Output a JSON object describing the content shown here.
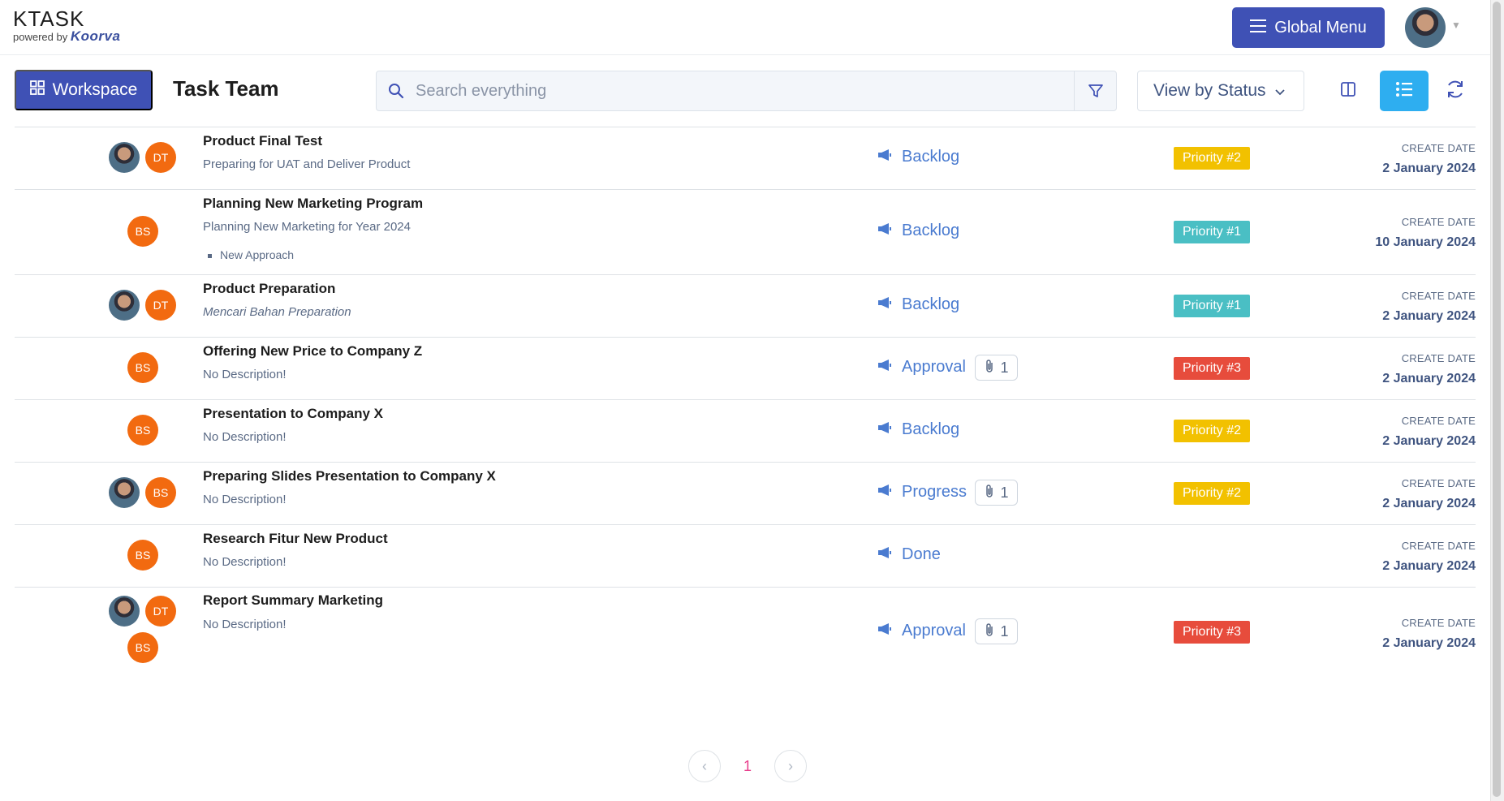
{
  "header": {
    "brand": "KTASK",
    "powered_by": "powered by",
    "powered_logo": "Koorva",
    "global_menu_label": "Global Menu"
  },
  "toolbar": {
    "workspace_label": "Workspace",
    "team_title": "Task Team",
    "search_placeholder": "Search everything",
    "view_select_value": "View by Status"
  },
  "colors": {
    "primary": "#3f51b5",
    "active_view": "#2eaef0",
    "avatar_initials": "#f26a10",
    "priority_1": "#4abfc4",
    "priority_2": "#f2c100",
    "priority_3": "#e74c3c"
  },
  "tasks": [
    {
      "title": "Product Final Test",
      "description": "Preparing for UAT and Deliver Product",
      "assignees": [
        "photo",
        "DT"
      ],
      "status": "Backlog",
      "attachments": "",
      "priority": "Priority #2",
      "date_label": "CREATE DATE",
      "date": "2 January 2024"
    },
    {
      "title": "Planning New Marketing Program",
      "description": "Planning New Marketing for Year 2024",
      "bullet": "New Approach",
      "assignees": [
        "BS"
      ],
      "status": "Backlog",
      "attachments": "",
      "priority": "Priority #1",
      "date_label": "CREATE DATE",
      "date": "10 January 2024"
    },
    {
      "title": "Product Preparation",
      "description": "Mencari Bahan Preparation",
      "assignees": [
        "photo",
        "DT"
      ],
      "status": "Backlog",
      "attachments": "",
      "priority": "Priority #1",
      "date_label": "CREATE DATE",
      "date": "2 January 2024"
    },
    {
      "title": "Offering New Price to Company Z",
      "description": "No Description!",
      "assignees": [
        "BS"
      ],
      "status": "Approval",
      "attachments": "1",
      "priority": "Priority #3",
      "date_label": "CREATE DATE",
      "date": "2 January 2024"
    },
    {
      "title": "Presentation to Company X",
      "description": "No Description!",
      "assignees": [
        "BS"
      ],
      "status": "Backlog",
      "attachments": "",
      "priority": "Priority #2",
      "date_label": "CREATE DATE",
      "date": "2 January 2024"
    },
    {
      "title": "Preparing Slides Presentation to Company X",
      "description": "No Description!",
      "assignees": [
        "photo",
        "BS"
      ],
      "status": "Progress",
      "attachments": "1",
      "priority": "Priority #2",
      "date_label": "CREATE DATE",
      "date": "2 January 2024"
    },
    {
      "title": "Research Fitur New Product",
      "description": "No Description!",
      "assignees": [
        "BS"
      ],
      "status": "Done",
      "attachments": "",
      "priority": "",
      "date_label": "CREATE DATE",
      "date": "2 January 2024"
    },
    {
      "title": "Report Summary Marketing",
      "description": "No Description!",
      "assignees": [
        "photo",
        "DT",
        "BS"
      ],
      "status": "Approval",
      "attachments": "1",
      "priority": "Priority #3",
      "date_label": "CREATE DATE",
      "date": "2 January 2024"
    }
  ],
  "pagination": {
    "current_page": "1"
  }
}
